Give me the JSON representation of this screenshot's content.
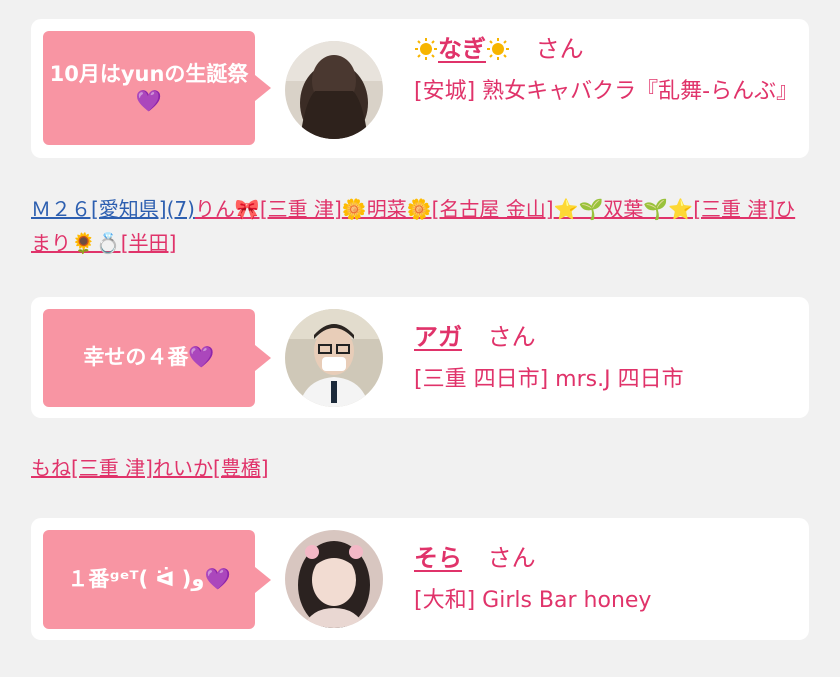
{
  "entries": [
    {
      "bubble": "10月はyunの生誕祭💜",
      "name": "なぎ",
      "honorific": "さん",
      "shop": "[安城] 熟女キャバクラ『乱舞-らんぶ』"
    },
    {
      "bubble": "幸せの４番💜",
      "name": "アガ",
      "honorific": "さん",
      "shop": "[三重 四日市] mrs.J 四日市"
    },
    {
      "bubble": "１番ᵍᵉᵀ( ᐛ )و💜",
      "name": "そら",
      "honorific": "さん",
      "shop": "[大和] Girls Bar honey"
    }
  ],
  "links1": [
    {
      "text": "Ｍ２６[愛知県](7)",
      "color": "#2d5fb0"
    },
    {
      "text": "りん🎀[三重 津]",
      "color": "#e0336a"
    },
    {
      "text": "🌼明菜🌼[名古屋 金山]",
      "color": "#e0336a"
    },
    {
      "text": "⭐️🌱双葉🌱⭐️[三重 津]",
      "color": "#e0336a"
    },
    {
      "text": "ひまり🌻💍[半田]",
      "color": "#e0336a"
    }
  ],
  "links2": [
    {
      "text": "もね[三重 津]",
      "color": "#e0336a"
    },
    {
      "text": "れいか[豊橋]",
      "color": "#e0336a"
    }
  ],
  "colors": {
    "pink": "#f895a3",
    "text_pink": "#e0336a",
    "blue": "#2d5fb0",
    "bg": "#f1f1f1"
  }
}
